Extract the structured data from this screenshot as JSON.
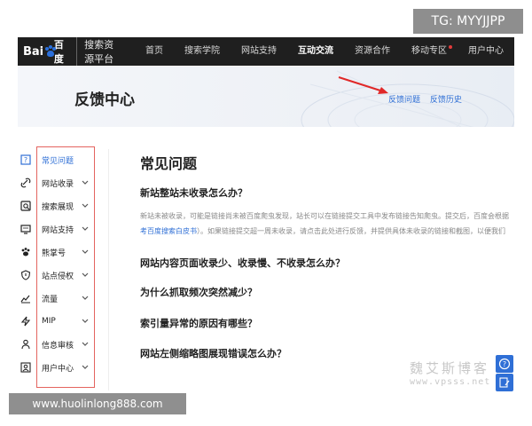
{
  "watermarks": {
    "tg": "TG: MYYJJPP",
    "url": "www.huolinlong888.com",
    "site_cn": "魏艾斯博客",
    "site_url": "www.vpsss.net"
  },
  "header": {
    "logo_text": "Bai",
    "logo_du": "百度",
    "platform": "搜索资源平台",
    "nav": [
      {
        "label": "首页"
      },
      {
        "label": "搜索学院"
      },
      {
        "label": "网站支持"
      },
      {
        "label": "互动交流"
      },
      {
        "label": "资源合作"
      },
      {
        "label": "移动专区"
      },
      {
        "label": "用户中心"
      }
    ]
  },
  "banner": {
    "title": "反馈中心",
    "link_faq": "反馈问题",
    "link_history": "反馈历史"
  },
  "sidebar": {
    "items": [
      {
        "label": "常见问题",
        "icon": "faq-icon",
        "active": true
      },
      {
        "label": "网站收录",
        "icon": "link-icon"
      },
      {
        "label": "搜索展现",
        "icon": "search-display-icon"
      },
      {
        "label": "网站支持",
        "icon": "monitor-icon"
      },
      {
        "label": "熊掌号",
        "icon": "bear-paw-icon"
      },
      {
        "label": "站点侵权",
        "icon": "shield-icon"
      },
      {
        "label": "流量",
        "icon": "traffic-icon"
      },
      {
        "label": "MIP",
        "icon": "lightning-icon"
      },
      {
        "label": "信息审核",
        "icon": "user-audit-icon"
      },
      {
        "label": "用户中心",
        "icon": "user-center-icon"
      }
    ]
  },
  "main": {
    "title": "常见问题",
    "q1": "新站整站未收录怎么办？",
    "a1_line1": "新站未被收录，可能是链接尚未被百度爬虫发现，站长可以在链接提交工具中发布链接告知爬虫。提交后，百度会根据",
    "a1_line2_link": "考百度搜索白皮书",
    "a1_line2_rest": "）。如果链接提交超一周未收录，请点击此处进行反馈，并提供具体未收录的链接和截图，以便我们",
    "q2": "网站内容页面收录少、收录慢、不收录怎么办？",
    "q3": "为什么抓取频次突然减少？",
    "q4": "索引量异常的原因有哪些？",
    "q5": "网站左侧缩略图展现错误怎么办？"
  },
  "colors": {
    "accent": "#2f6fd6",
    "highlight": "#e4645f",
    "topbar": "#1f1f1f",
    "arrow": "#e02828"
  }
}
